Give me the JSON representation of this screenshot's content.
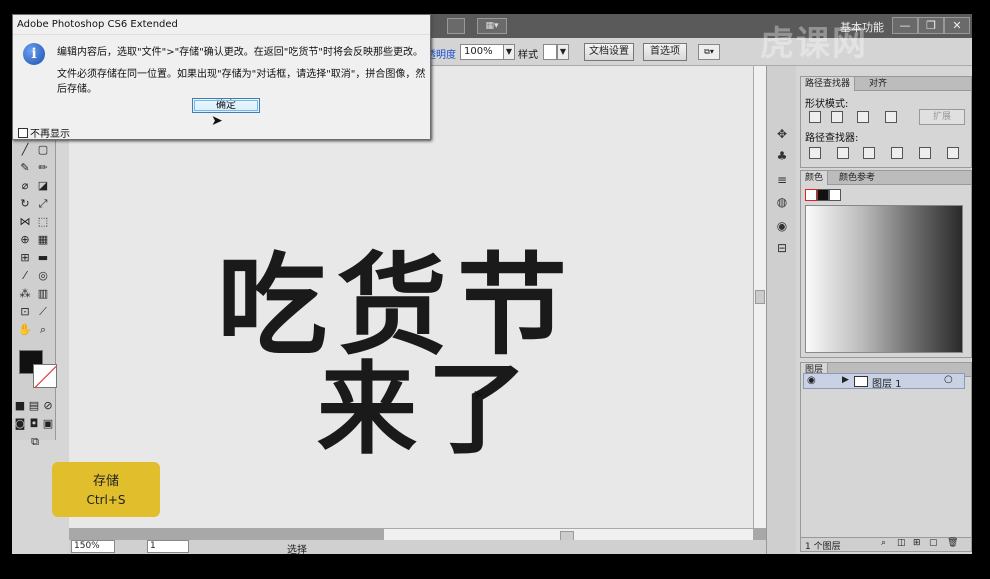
{
  "titlebar": {
    "workspace": "基本功能",
    "minimize": "—",
    "restore": "❐",
    "close": "✕",
    "arrange": "▦▾"
  },
  "options": {
    "opacity_label": "透明度",
    "opacity_value": "100%",
    "style_label": "样式",
    "doc_settings": "文档设置",
    "preferences": "首选项"
  },
  "dialog": {
    "title": "Adobe Photoshop CS6 Extended",
    "message_line1": "编辑内容后，选取\"文件\">\"存储\"确认更改。在返回\"吃货节\"时将会反映那些更改。",
    "message_line2": "文件必须存储在同一位置。如果出现\"存储为\"对话框，请选择\"取消\"，拼合图像，然后存储。",
    "ok_label": "确定",
    "dont_show_label": "不再显示",
    "info_glyph": "i"
  },
  "canvas": {
    "line1": "吃货节",
    "line2": "来了"
  },
  "statusbar": {
    "zoom": "150%",
    "page": "1",
    "status": "选择"
  },
  "panels": {
    "pathfinder_tab": "路径查找器",
    "align_tab": "对齐",
    "shape_modes": "形状模式:",
    "expand_label": "扩展",
    "pathfinders": "路径查找器:",
    "color_tab": "颜色",
    "color_guide_tab": "颜色参考",
    "layers_tab": "图层",
    "layer_name": "图层 1",
    "layer_count": "1 个图层"
  },
  "hint": {
    "action": "存储",
    "shortcut": "Ctrl+S"
  },
  "watermark": "虎课网",
  "colors": {
    "hint_bg": "#e1bf2c",
    "ok_border": "#3c7fb1",
    "layer_selected": "#c8d2e4"
  }
}
